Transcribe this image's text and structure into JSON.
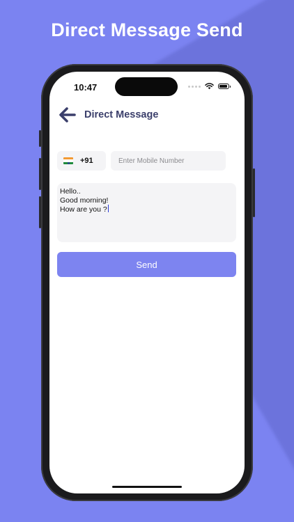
{
  "promo": {
    "title": "Direct Message Send"
  },
  "status_bar": {
    "time": "10:47"
  },
  "nav": {
    "title": "Direct Message",
    "back_icon": "arrow-left-icon"
  },
  "form": {
    "country_code": "+91",
    "country_flag": "india-flag-icon",
    "mobile_placeholder": "Enter Mobile Number",
    "mobile_value": "",
    "message_lines": [
      "Hello..",
      "Good morning!",
      "How are you ?"
    ],
    "send_label": "Send"
  },
  "colors": {
    "background": "#7b83f1",
    "accent": "#7d84f0",
    "title_text": "#3b3f6b",
    "field_bg": "#f4f4f6"
  }
}
